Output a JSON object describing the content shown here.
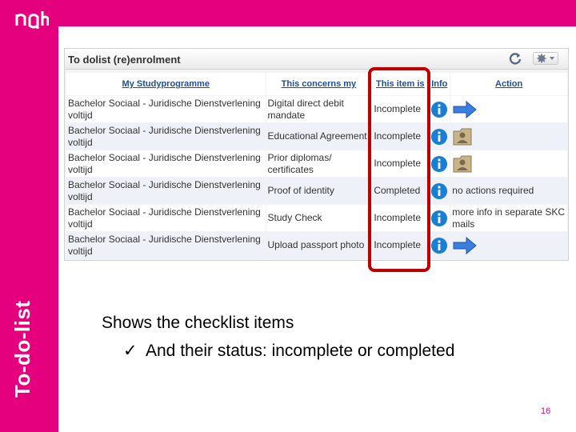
{
  "slide": {
    "side_title": "To-do-list",
    "page_number": "16",
    "brand_color": "#e5007d"
  },
  "panel": {
    "title": "To dolist (re)enrolment",
    "columns": [
      "My Studyprogramme",
      "This concerns my",
      "This item is",
      "Info",
      "Action"
    ],
    "rows": [
      {
        "programme": "Bachelor Sociaal - Juridische Dienstverlening voltijd",
        "concerns": "Digital direct debit mandate",
        "status": "Incomplete",
        "info_icon": "info-icon",
        "action_icon": "arrow-right-icon",
        "action_text": ""
      },
      {
        "programme": "Bachelor Sociaal - Juridische Dienstverlening voltijd",
        "concerns": "Educational Agreement",
        "status": "Incomplete",
        "info_icon": "info-icon",
        "action_icon": "folder-person-icon",
        "action_text": ""
      },
      {
        "programme": "Bachelor Sociaal - Juridische Dienstverlening voltijd",
        "concerns": "Prior diplomas/ certificates",
        "status": "Incomplete",
        "info_icon": "info-icon",
        "action_icon": "folder-person-icon",
        "action_text": ""
      },
      {
        "programme": "Bachelor Sociaal - Juridische Dienstverlening voltijd",
        "concerns": "Proof of identity",
        "status": "Completed",
        "info_icon": "info-icon",
        "action_icon": "",
        "action_text": "no actions required"
      },
      {
        "programme": "Bachelor Sociaal - Juridische Dienstverlening voltijd",
        "concerns": "Study Check",
        "status": "Incomplete",
        "info_icon": "info-icon",
        "action_icon": "",
        "action_text": "more info in separate SKC mails"
      },
      {
        "programme": "Bachelor Sociaal - Juridische Dienstverlening voltijd",
        "concerns": "Upload passport photo",
        "status": "Incomplete",
        "info_icon": "info-icon",
        "action_icon": "arrow-right-icon",
        "action_text": ""
      }
    ]
  },
  "bullets": {
    "main": "Shows the checklist items",
    "sub": "And their status: incomplete or completed",
    "sub_marker": "✓"
  },
  "colors": {
    "link": "#1f4e9a",
    "highlight": "#c00000",
    "info_blue": "#1a7fd4",
    "row_alt": "#eef2f8"
  }
}
